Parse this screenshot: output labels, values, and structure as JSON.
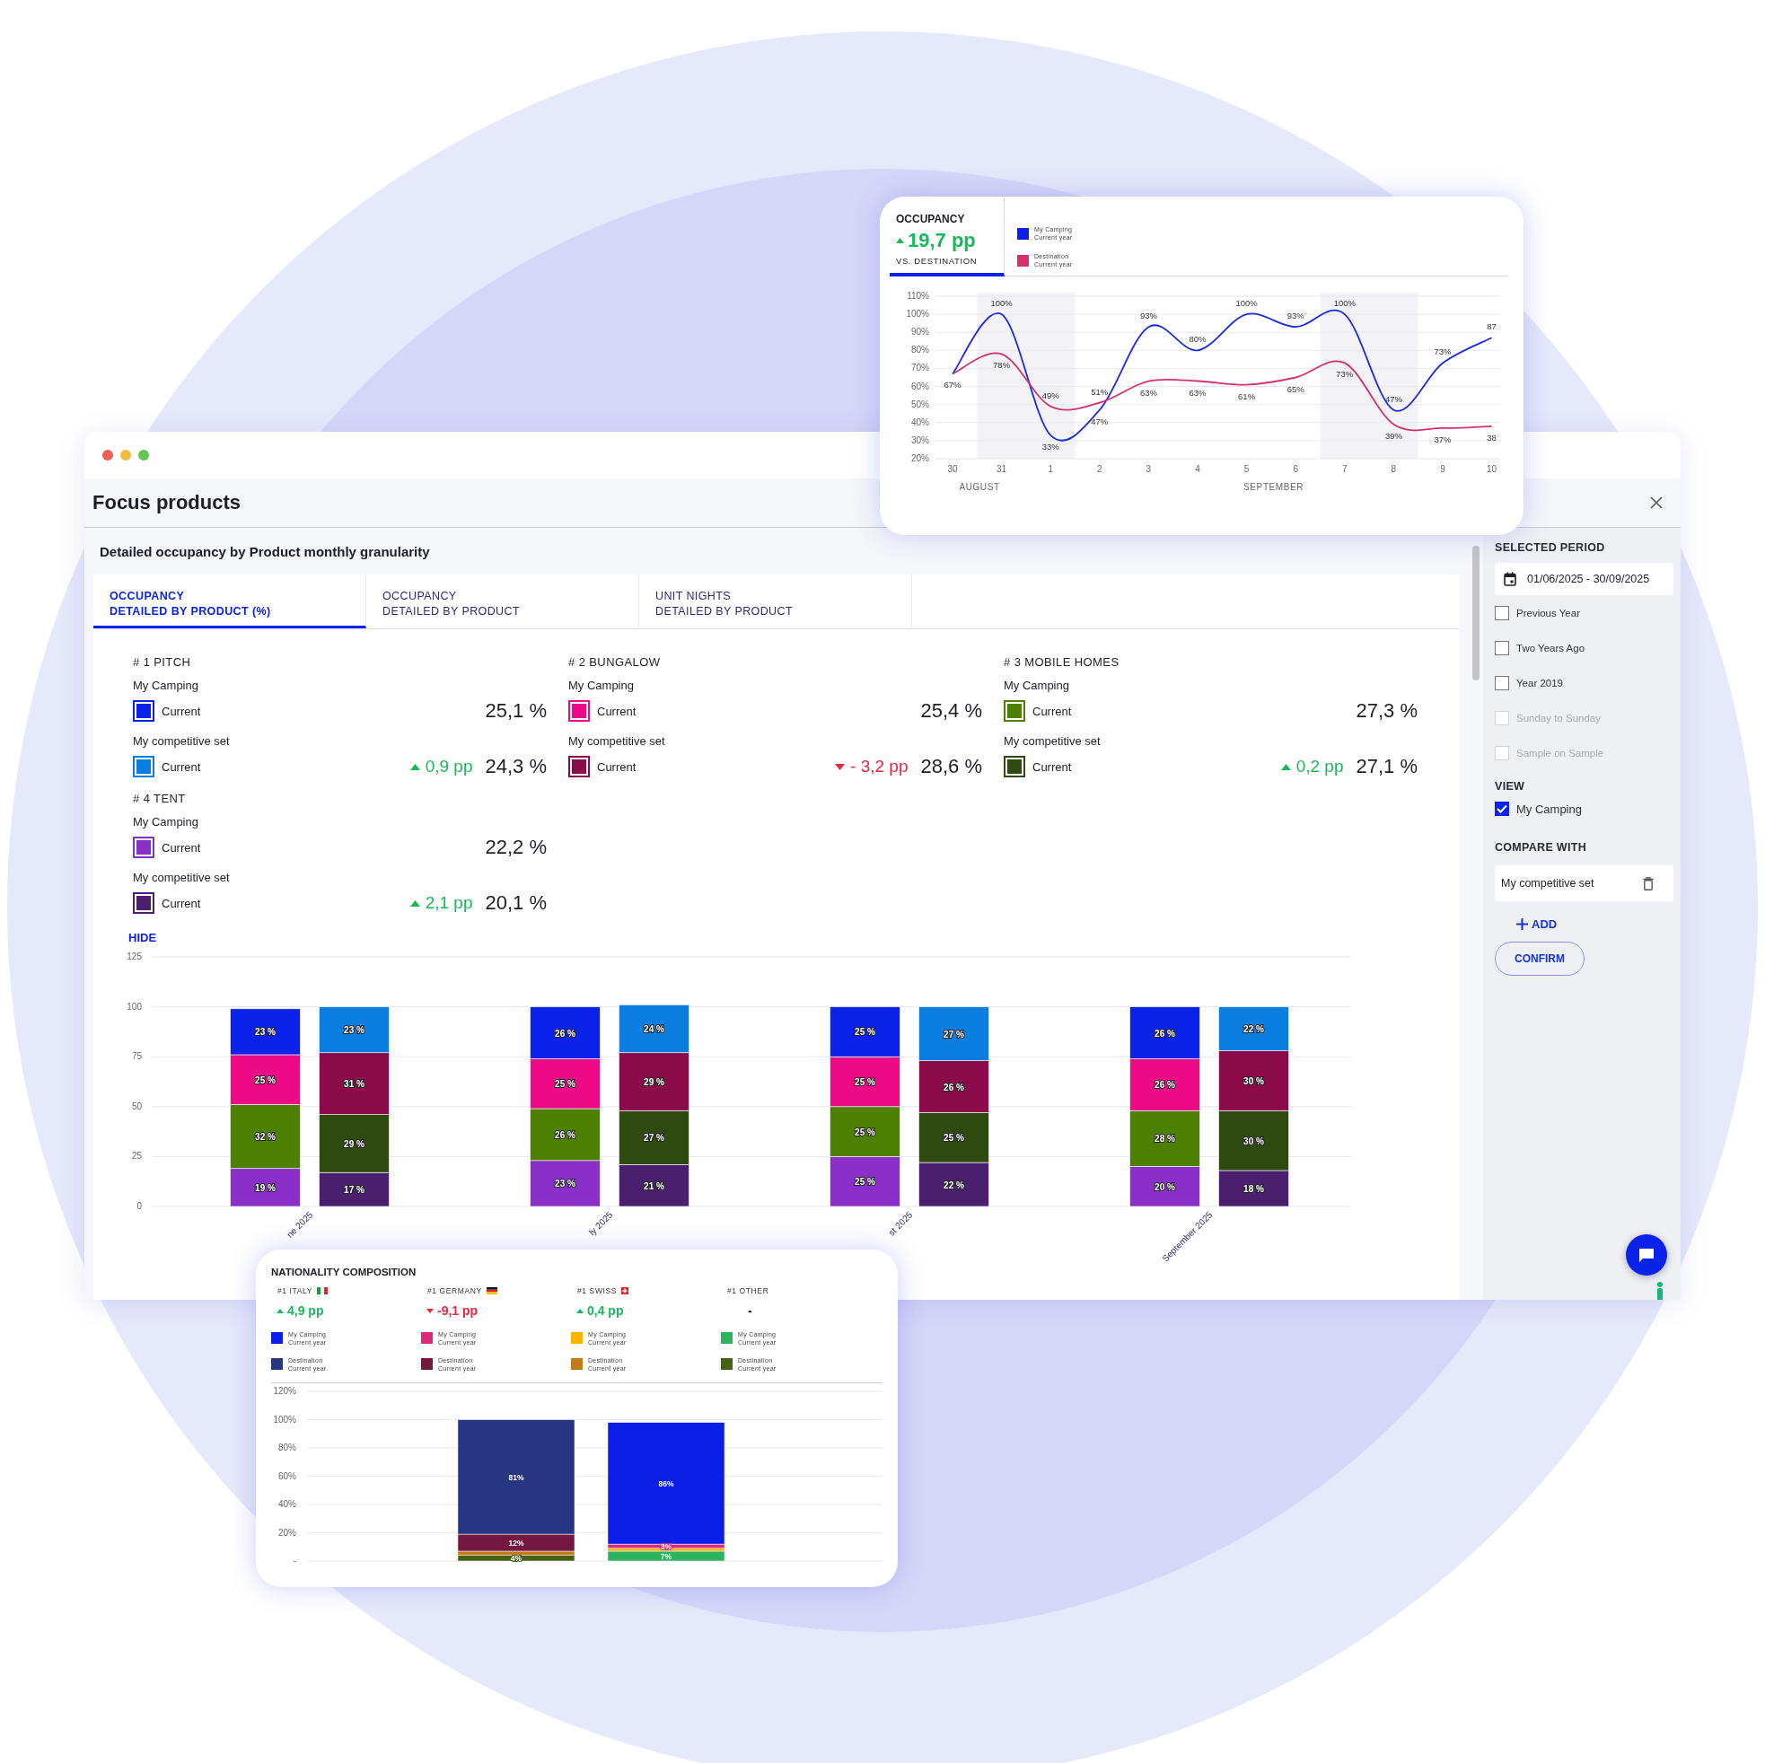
{
  "main_window": {
    "title": "Focus products",
    "subtitle": "Detailed occupancy by Product monthly granularity",
    "tabs": [
      {
        "line1": "OCCUPANCY",
        "line2": "DETAILED BY PRODUCT (%)",
        "selected": true
      },
      {
        "line1": "OCCUPANCY",
        "line2": "DETAILED BY PRODUCT",
        "selected": false
      },
      {
        "line1": "UNIT NIGHTS",
        "line2": "DETAILED BY PRODUCT",
        "selected": false
      }
    ],
    "products": [
      {
        "title": "# 1 PITCH",
        "rows": [
          {
            "group": "My Camping",
            "color": "#0a22ea",
            "label": "Current",
            "value": "25,1 %"
          },
          {
            "group": "My competitive set",
            "color": "#0a7ee0",
            "label": "Current",
            "delta": "0,9 pp",
            "kind": "up",
            "value": "24,3 %"
          }
        ]
      },
      {
        "title": "# 2 BUNGALOW",
        "rows": [
          {
            "group": "My Camping",
            "color": "#ee0a86",
            "label": "Current",
            "value": "25,4 %"
          },
          {
            "group": "My competitive set",
            "color": "#8a0a4a",
            "label": "Current",
            "delta": "- 3,2 pp",
            "kind": "down",
            "value": "28,6 %"
          }
        ]
      },
      {
        "title": "# 3 MOBILE HOMES",
        "rows": [
          {
            "group": "My Camping",
            "color": "#4e8000",
            "label": "Current",
            "value": "27,3 %"
          },
          {
            "group": "My competitive set",
            "color": "#2e4a10",
            "label": "Current",
            "delta": "0,2 pp",
            "kind": "up",
            "value": "27,1 %"
          }
        ]
      },
      {
        "title": "# 4 TENT",
        "rows": [
          {
            "group": "My Camping",
            "color": "#8a30c8",
            "label": "Current",
            "value": "22,2 %"
          },
          {
            "group": "My competitive set",
            "color": "#4a1f6e",
            "label": "Current",
            "delta": "2,1 pp",
            "kind": "up",
            "value": "20,1 %"
          }
        ]
      }
    ],
    "hide_link": "HIDE",
    "chart_data": {
      "type": "bar",
      "stacked": true,
      "grid": true,
      "categories": [
        "ne 2025",
        "ly 2025",
        "st 2025",
        "September 2025"
      ],
      "ylim": [
        0,
        125
      ],
      "yticks": [
        0,
        25,
        50,
        75,
        100,
        125
      ],
      "data_labels": true,
      "series": [
        {
          "color": "#8a30c8",
          "values": [
            19,
            23,
            25,
            20
          ],
          "value_labels": [
            "19 %",
            "23 %",
            "25 %",
            "20 %"
          ]
        },
        {
          "color": "#4e8000",
          "values": [
            32,
            26,
            25,
            28
          ],
          "value_labels": [
            "32 %",
            "26 %",
            "25 %",
            "28 %"
          ]
        },
        {
          "color": "#ee0a86",
          "values": [
            25,
            25,
            25,
            26
          ],
          "value_labels": [
            "25 %",
            "25 %",
            "25 %",
            "26 %"
          ]
        },
        {
          "color": "#0a22ea",
          "values": [
            23,
            26,
            25,
            26
          ],
          "value_labels": [
            "23 %",
            "26 %",
            "25 %",
            "26 %"
          ]
        }
      ]
    },
    "competitive_set": {
      "chart_data": {
        "type": "bar",
        "stacked": true,
        "ylim": [
          0,
          125
        ],
        "data_labels": true,
        "series": [
          {
            "color": "#4a1f6e",
            "values": [
              17,
              21,
              22,
              18
            ],
            "value_labels": [
              "17 %",
              "21 %",
              "22 %",
              "18 %"
            ]
          },
          {
            "color": "#2e4a10",
            "values": [
              29,
              27,
              25,
              30
            ],
            "value_labels": [
              "29 %",
              "27 %",
              "25 %",
              "30 %"
            ]
          },
          {
            "color": "#8a0a4a",
            "values": [
              31,
              29,
              26,
              30
            ],
            "value_labels": [
              "31 %",
              "29 %",
              "26 %",
              "30 %"
            ]
          },
          {
            "color": "#0a7ee0",
            "values": [
              23,
              24,
              27,
              22
            ],
            "value_labels": [
              "23 %",
              "24 %",
              "27 %",
              "22 %"
            ]
          }
        ]
      }
    }
  },
  "sidebar": {
    "period_title": "SELECTED PERIOD",
    "date_range": "01/06/2025 - 30/09/2025",
    "comparisons": [
      {
        "label": "Previous Year",
        "checked": false,
        "disabled": false
      },
      {
        "label": "Two Years Ago",
        "checked": false,
        "disabled": false
      },
      {
        "label": "Year 2019",
        "checked": false,
        "disabled": false
      },
      {
        "label": "Sunday to Sunday",
        "checked": false,
        "disabled": true
      },
      {
        "label": "Sample on Sample",
        "checked": false,
        "disabled": true
      }
    ],
    "view_title": "VIEW",
    "view_options": [
      {
        "label": "My Camping",
        "checked": true,
        "disabled": false
      }
    ],
    "compare_title": "COMPARE WITH",
    "compare_items": [
      {
        "label": "My competitive set"
      }
    ],
    "add_button": "ADD",
    "confirm_button": "CONFIRM"
  },
  "occupancy_card": {
    "title": "OCCUPANCY",
    "delta": "19,7 pp",
    "kind": "up",
    "subtitle": "VS. DESTINATION",
    "legend": [
      {
        "line1": "My Camping",
        "line2": "Current year",
        "color": "#0a1ee8"
      },
      {
        "line1": "Destination",
        "line2": "Current year",
        "color": "#d6306e"
      }
    ],
    "chart_data": {
      "type": "line",
      "grid": true,
      "categories": [
        "30",
        "31",
        "1",
        "2",
        "3",
        "4",
        "5",
        "6",
        "7",
        "8",
        "9",
        "10"
      ],
      "ylim": [
        20,
        110
      ],
      "yticks": [
        {
          "value": 20,
          "label": "20%"
        },
        {
          "value": 30,
          "label": "30%"
        },
        {
          "value": 40,
          "label": "40%"
        },
        {
          "value": 50,
          "label": "50%"
        },
        {
          "value": 60,
          "label": "60%"
        },
        {
          "value": 70,
          "label": "70%"
        },
        {
          "value": 80,
          "label": "80%"
        },
        {
          "value": 90,
          "label": "90%"
        },
        {
          "value": 100,
          "label": "100%"
        },
        {
          "value": 110,
          "label": "110%"
        }
      ],
      "series": [
        {
          "color": "#1a2be6",
          "values": [
            67,
            100,
            33,
            47,
            93,
            80,
            100,
            93,
            100,
            47,
            73,
            87
          ],
          "value_labels": [
            null,
            "100%",
            "33%",
            "47%",
            "93%",
            "80%",
            "100%",
            "93%",
            "100%",
            "47%",
            "73%",
            "87"
          ]
        },
        {
          "color": "#d6306e",
          "values": [
            67,
            78,
            49,
            51,
            63,
            63,
            61,
            65,
            73,
            39,
            37,
            38
          ],
          "value_labels": [
            "67%",
            "78%",
            "49%",
            "51%",
            "63%",
            "63%",
            "61%",
            "65%",
            "73%",
            "39%",
            "37%",
            "38"
          ]
        }
      ],
      "annotations": [
        "AUGUST",
        "SEPTEMBER"
      ]
    }
  },
  "nationality_card": {
    "title": "NATIONALITY COMPOSITION",
    "countries": [
      {
        "label": "#1 ITALY",
        "kind": "italy",
        "delta": "4,9 pp",
        "increase": true,
        "legend": [
          {
            "line1": "My Camping",
            "line2": "Current year",
            "color": "#0a1ee8"
          },
          {
            "line1": "Destination",
            "line2": "Current year",
            "color": "#283580"
          }
        ]
      },
      {
        "label": "#1 GERMANY",
        "kind": "germany",
        "delta": "-9,1 pp",
        "increase": false,
        "legend": [
          {
            "line1": "My Camping",
            "line2": "Current year",
            "color": "#dc2a78"
          },
          {
            "line1": "Destination",
            "line2": "Current year",
            "color": "#741840"
          }
        ]
      },
      {
        "label": "#1 SWISS",
        "kind": "swiss",
        "delta": "0,4 pp",
        "increase": true,
        "legend": [
          {
            "line1": "My Camping",
            "line2": "Current year",
            "color": "#ffb300"
          },
          {
            "line1": "Destination",
            "line2": "Current year",
            "color": "#c07a1a"
          }
        ]
      },
      {
        "label": "#1 OTHER",
        "kind": "plain",
        "delta": "-",
        "legend": [
          {
            "line1": "My Camping",
            "line2": "Current year",
            "color": "#2db35e"
          },
          {
            "line1": "Destination",
            "line2": "Current year",
            "color": "#46601a"
          }
        ]
      }
    ],
    "chart_data": {
      "type": "bar",
      "stacked": true,
      "grid": true,
      "ylim": [
        0,
        120
      ],
      "yticks": [
        {
          "value": 0,
          "label": "-"
        },
        {
          "value": 20,
          "label": "20%"
        },
        {
          "value": 40,
          "label": "40%"
        },
        {
          "value": 60,
          "label": "60%"
        },
        {
          "value": 80,
          "label": "80%"
        },
        {
          "value": 100,
          "label": "100%"
        },
        {
          "value": 120,
          "label": "120%"
        }
      ],
      "series": [
        {
          "color": "#46601a",
          "values": [
            4,
            null
          ],
          "value_labels": [
            "4%",
            null
          ]
        },
        {
          "color": "#c07a1a",
          "values": [
            3,
            null
          ]
        },
        {
          "color": "#741840",
          "values": [
            12,
            null
          ],
          "value_labels": [
            "12%",
            null
          ]
        },
        {
          "color": "#283580",
          "values": [
            81,
            null
          ],
          "value_labels": [
            "81%",
            null
          ]
        },
        {
          "color": "#2db35e",
          "values": [
            null,
            7
          ],
          "value_labels": [
            null,
            "7%"
          ]
        },
        {
          "color": "#ffb300",
          "values": [
            null,
            2
          ]
        },
        {
          "color": "#dc2a78",
          "values": [
            null,
            3
          ],
          "value_labels": [
            null,
            "3%"
          ]
        },
        {
          "color": "#0a1ee8",
          "values": [
            null,
            86
          ],
          "value_labels": [
            null,
            "86%"
          ]
        }
      ]
    }
  }
}
